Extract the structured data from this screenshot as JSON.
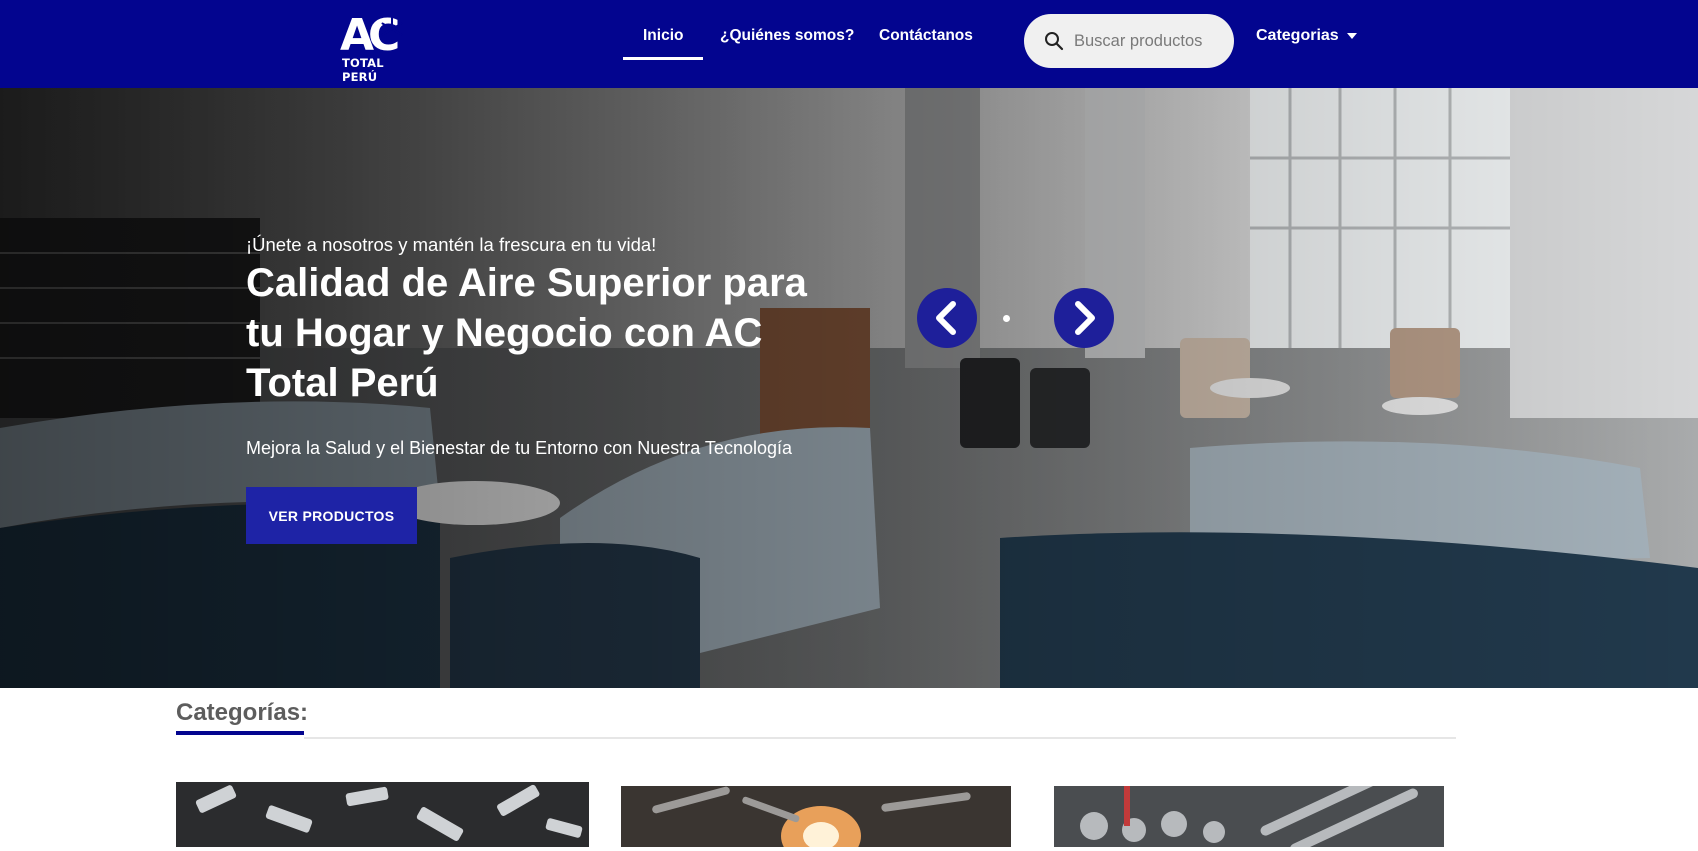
{
  "brand": {
    "logo_text": "TOTAL PERÚ"
  },
  "nav": {
    "items": [
      {
        "label": "Inicio",
        "active": true
      },
      {
        "label": "¿Quiénes somos?",
        "active": false
      },
      {
        "label": "Contáctanos",
        "active": false
      }
    ]
  },
  "search": {
    "placeholder": "Buscar productos",
    "icon": "search-icon"
  },
  "categories_menu": {
    "label": "Categorias",
    "icon": "caret-down-icon"
  },
  "hero": {
    "eyebrow": "¡Únete a nosotros y mantén la frescura en tu vida!",
    "title": "Calidad de Aire Superior para tu Hogar y Negocio con AC Total Perú",
    "subtitle": "Mejora la Salud y el Bienestar de tu Entorno con Nuestra Tecnología",
    "cta_label": "VER PRODUCTOS",
    "slider": {
      "prev_icon": "chevron-left-icon",
      "next_icon": "chevron-right-icon"
    }
  },
  "categories_section": {
    "title": "Categorías:"
  },
  "colors": {
    "header_bg": "#03058f",
    "accent": "#1e23a6",
    "arrow_bg": "#1e1f9a",
    "section_title": "#5d5d5d"
  }
}
